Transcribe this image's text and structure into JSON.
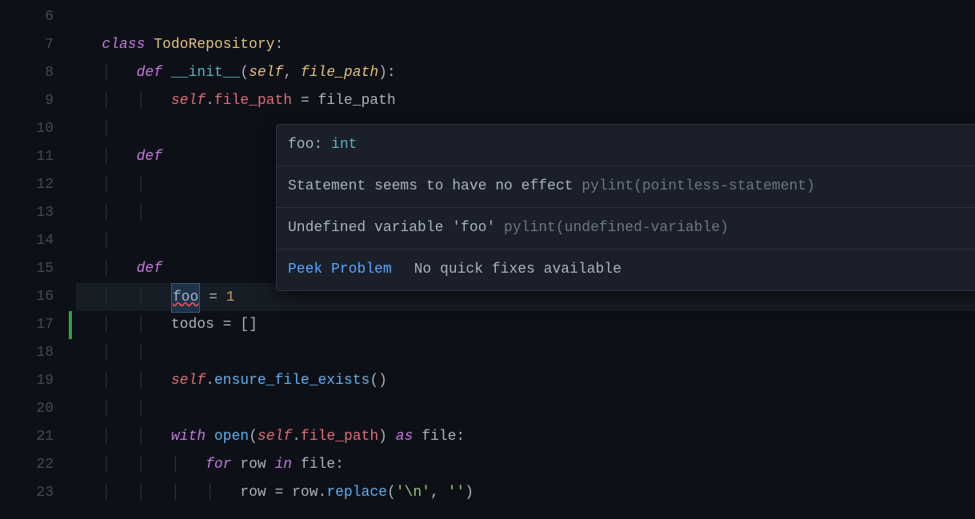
{
  "lineNumbers": [
    "6",
    "7",
    "8",
    "9",
    "10",
    "11",
    "12",
    "13",
    "14",
    "15",
    "16",
    "17",
    "18",
    "19",
    "20",
    "21",
    "22",
    "23"
  ],
  "code": {
    "l7": {
      "keyword": "class",
      "name": "TodoRepository",
      "colon": ":"
    },
    "l8": {
      "keyword": "def",
      "name": "__init__",
      "lp": "(",
      "p1": "self",
      "comma": ", ",
      "p2": "file_path",
      "rp": "):"
    },
    "l9": {
      "self": "self",
      "dot": ".",
      "prop": "file_path",
      "eq": " = ",
      "rhs": "file_path"
    },
    "l11": {
      "keyword": "def"
    },
    "l15": {
      "keyword": "def"
    },
    "l16": {
      "foo": "foo",
      "eq": " = ",
      "num": "1"
    },
    "l17": {
      "lhs": "todos",
      "eq": " = ",
      "rhs": "[]"
    },
    "l19": {
      "self": "self",
      "dot": ".",
      "call": "ensure_file_exists",
      "parens": "()"
    },
    "l21": {
      "with": "with",
      "open": "open",
      "lp": "(",
      "self": "self",
      "dot": ".",
      "prop": "file_path",
      "rp": ")",
      "as": " as ",
      "var": "file",
      "colon": ":"
    },
    "l22": {
      "for": "for",
      "var": "row",
      "in": " in ",
      "iter": "file",
      "colon": ":"
    },
    "l23": {
      "lhs": "row",
      "eq": " = ",
      "rhs": "row",
      "dot": ".",
      "call": "replace",
      "lp": "(",
      "s1": "'\\n'",
      "comma": ", ",
      "s2": "''",
      "rp": ")"
    }
  },
  "hover": {
    "sig": {
      "name": "foo",
      "colon": ": ",
      "type": "int"
    },
    "diag1": {
      "msg": "Statement seems to have no effect ",
      "src": "pylint(pointless-statement)"
    },
    "diag2": {
      "msg": "Undefined variable 'foo' ",
      "src": "pylint(undefined-variable)"
    },
    "peek": "Peek Problem",
    "quickfix": "No quick fixes available"
  }
}
